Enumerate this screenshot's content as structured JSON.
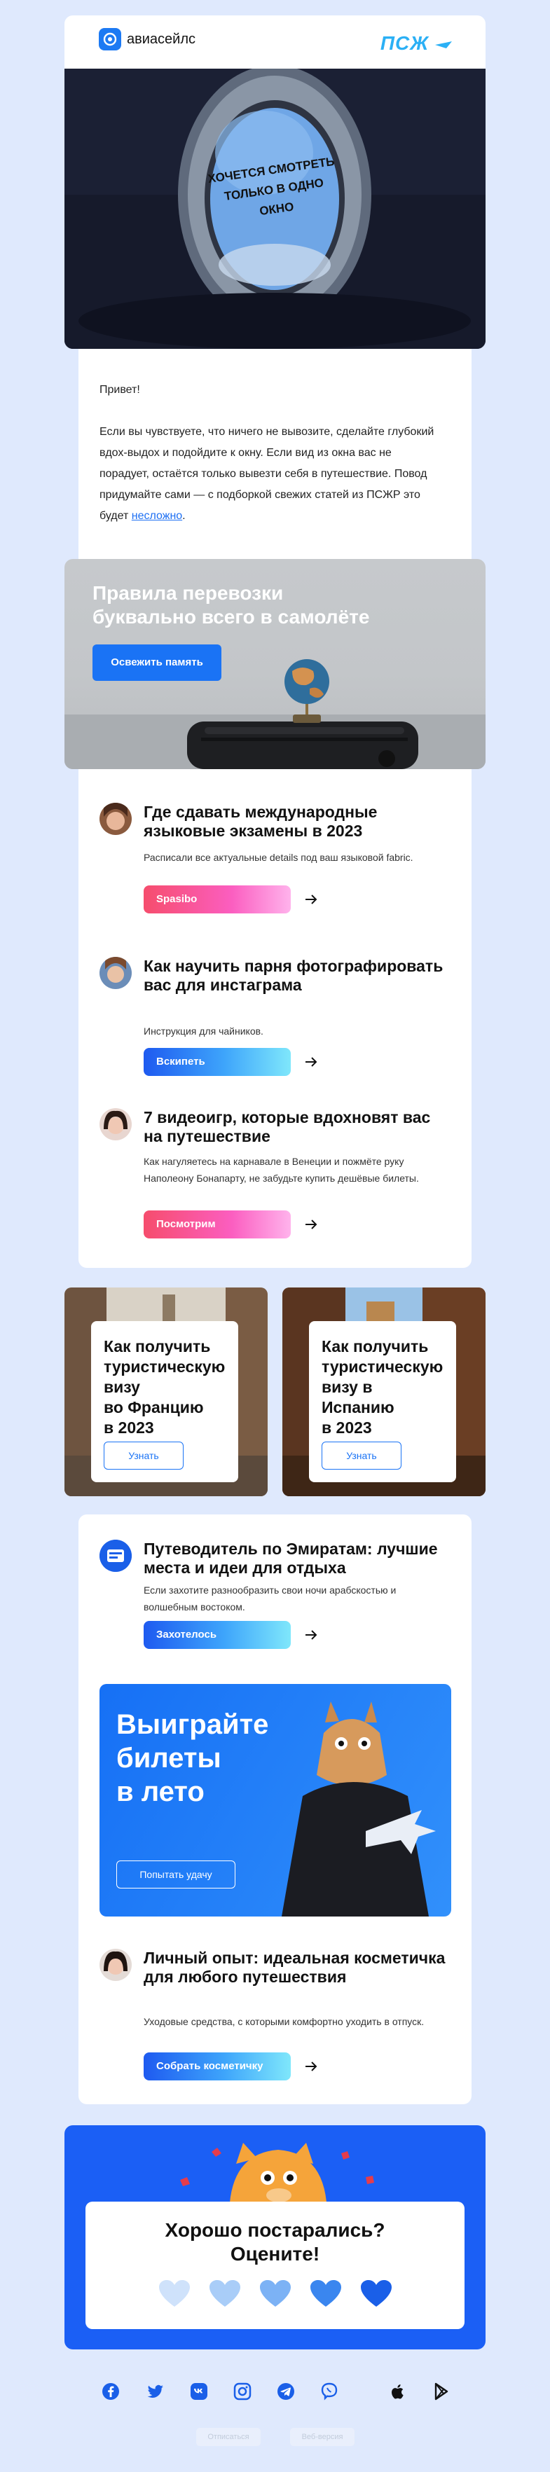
{
  "header": {
    "logo_text": "авиасейлс",
    "brand_right": "ПСЖ"
  },
  "hero": {
    "window_text": [
      "ХОЧЕТСЯ СМОТРЕТЬ",
      "ТОЛЬКО В ОДНО",
      "ОКНО"
    ]
  },
  "intro": {
    "greeting": "Привет!",
    "body_before_link": "Если вы чувствуете, что ничего не вывозите, сделайте глубокий вдох-выдох и подойдите к окну. Если вид из окна вас не порадует, остаётся только вывезти себя в путешествие. Повод придумайте сами — с подборкой свежих статей из ПСЖР это будет ",
    "link_text": "несложно",
    "body_after_link": "."
  },
  "banner": {
    "title": "Правила перевозки буквально всего в самолёте",
    "button": "Освежить память"
  },
  "articles": [
    {
      "title": "Где сдавать международные языковые экзамены в 2023",
      "desc": "Расписали все актуальные details под ваш языковой fabric.",
      "button": "Spasibo"
    },
    {
      "title": "Как научить парня фотографировать вас для инстаграма",
      "desc": "Инструкция для чайников.",
      "button": "Вскипеть"
    },
    {
      "title": "7 видеоигр, которые вдохновят вас на путешествие",
      "desc": "Как нагуляетесь на карнавале в Венеции и пожмёте руку Наполеону Бонапарту, не забудьте купить дешёвые билеты.",
      "button": "Посмотрим"
    }
  ],
  "visa": [
    {
      "title_lines": [
        "Как получить",
        "туристическую",
        "визу",
        "во Францию",
        "в 2023"
      ],
      "button": "Узнать"
    },
    {
      "title_lines": [
        "Как получить",
        "туристическую",
        "визу в",
        "Испанию",
        "в 2023"
      ],
      "button": "Узнать"
    }
  ],
  "guide": {
    "title": "Путеводитель по Эмиратам: лучшие места и идеи для отдыха",
    "desc": "Если захотите разнообразить свои ночи арабскостью и волшебным востоком.",
    "button": "Захотелось"
  },
  "promo": {
    "title_lines": [
      "Выиграйте",
      "билеты",
      "в лето"
    ],
    "button": "Попытать удачу"
  },
  "cosmetics": {
    "title": "Личный опыт: идеальная косметичка для любого путешествия",
    "desc": "Уходовые средства, с которыми комфортно уходить в отпуск.",
    "button": "Собрать косметичку"
  },
  "rating": {
    "title_lines": [
      "Хорошо постарались?",
      "Оцените!"
    ],
    "heart_colors": [
      "#cfe2fb",
      "#a9cdf8",
      "#7cb2f5",
      "#3a86ef",
      "#1a5fe8"
    ]
  },
  "social_icons": [
    "facebook-icon",
    "twitter-icon",
    "vk-icon",
    "instagram-icon",
    "telegram-icon",
    "viber-icon",
    "apple-icon",
    "google-play-icon"
  ],
  "footer": {
    "unsubscribe": "Отписаться",
    "web_version": "Веб-версия"
  },
  "colors": {
    "page_bg": "#dfe9fd",
    "accent_blue": "#1a73f5",
    "pszh_cyan": "#2bb0f5"
  }
}
